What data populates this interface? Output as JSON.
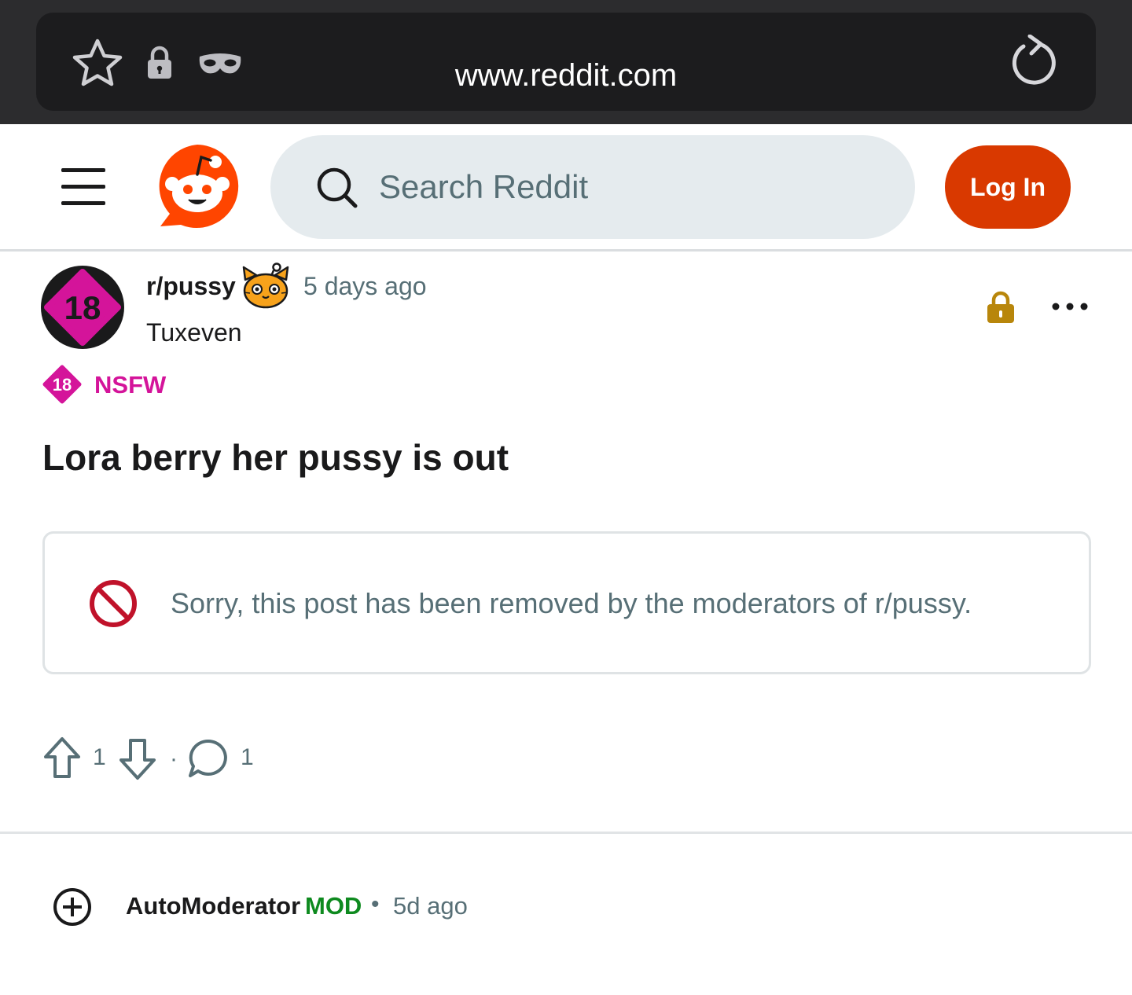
{
  "browser": {
    "url": "www.reddit.com",
    "icons": [
      "star-icon",
      "lock-icon",
      "incognito-mask-icon",
      "reload-icon"
    ]
  },
  "header": {
    "search_placeholder": "Search Reddit",
    "login_label": "Log In",
    "brand_color": "#d93900"
  },
  "post": {
    "subreddit": "r/pussy",
    "avatar_text": "18",
    "time": "5 days ago",
    "author": "Tuxeven",
    "nsfw_badge_text": "18",
    "nsfw_label": "NSFW",
    "title": "Lora berry her pussy is out",
    "removed_message": "Sorry, this post has been removed by the moderators of r/pussy.",
    "votes": "1",
    "separator": "·",
    "comments": "1",
    "nsfw_color": "#d4149a"
  },
  "comment": {
    "author": "AutoModerator",
    "badge": "MOD",
    "separator": "•",
    "time": "5d ago",
    "mod_color": "#0e8a1f"
  }
}
